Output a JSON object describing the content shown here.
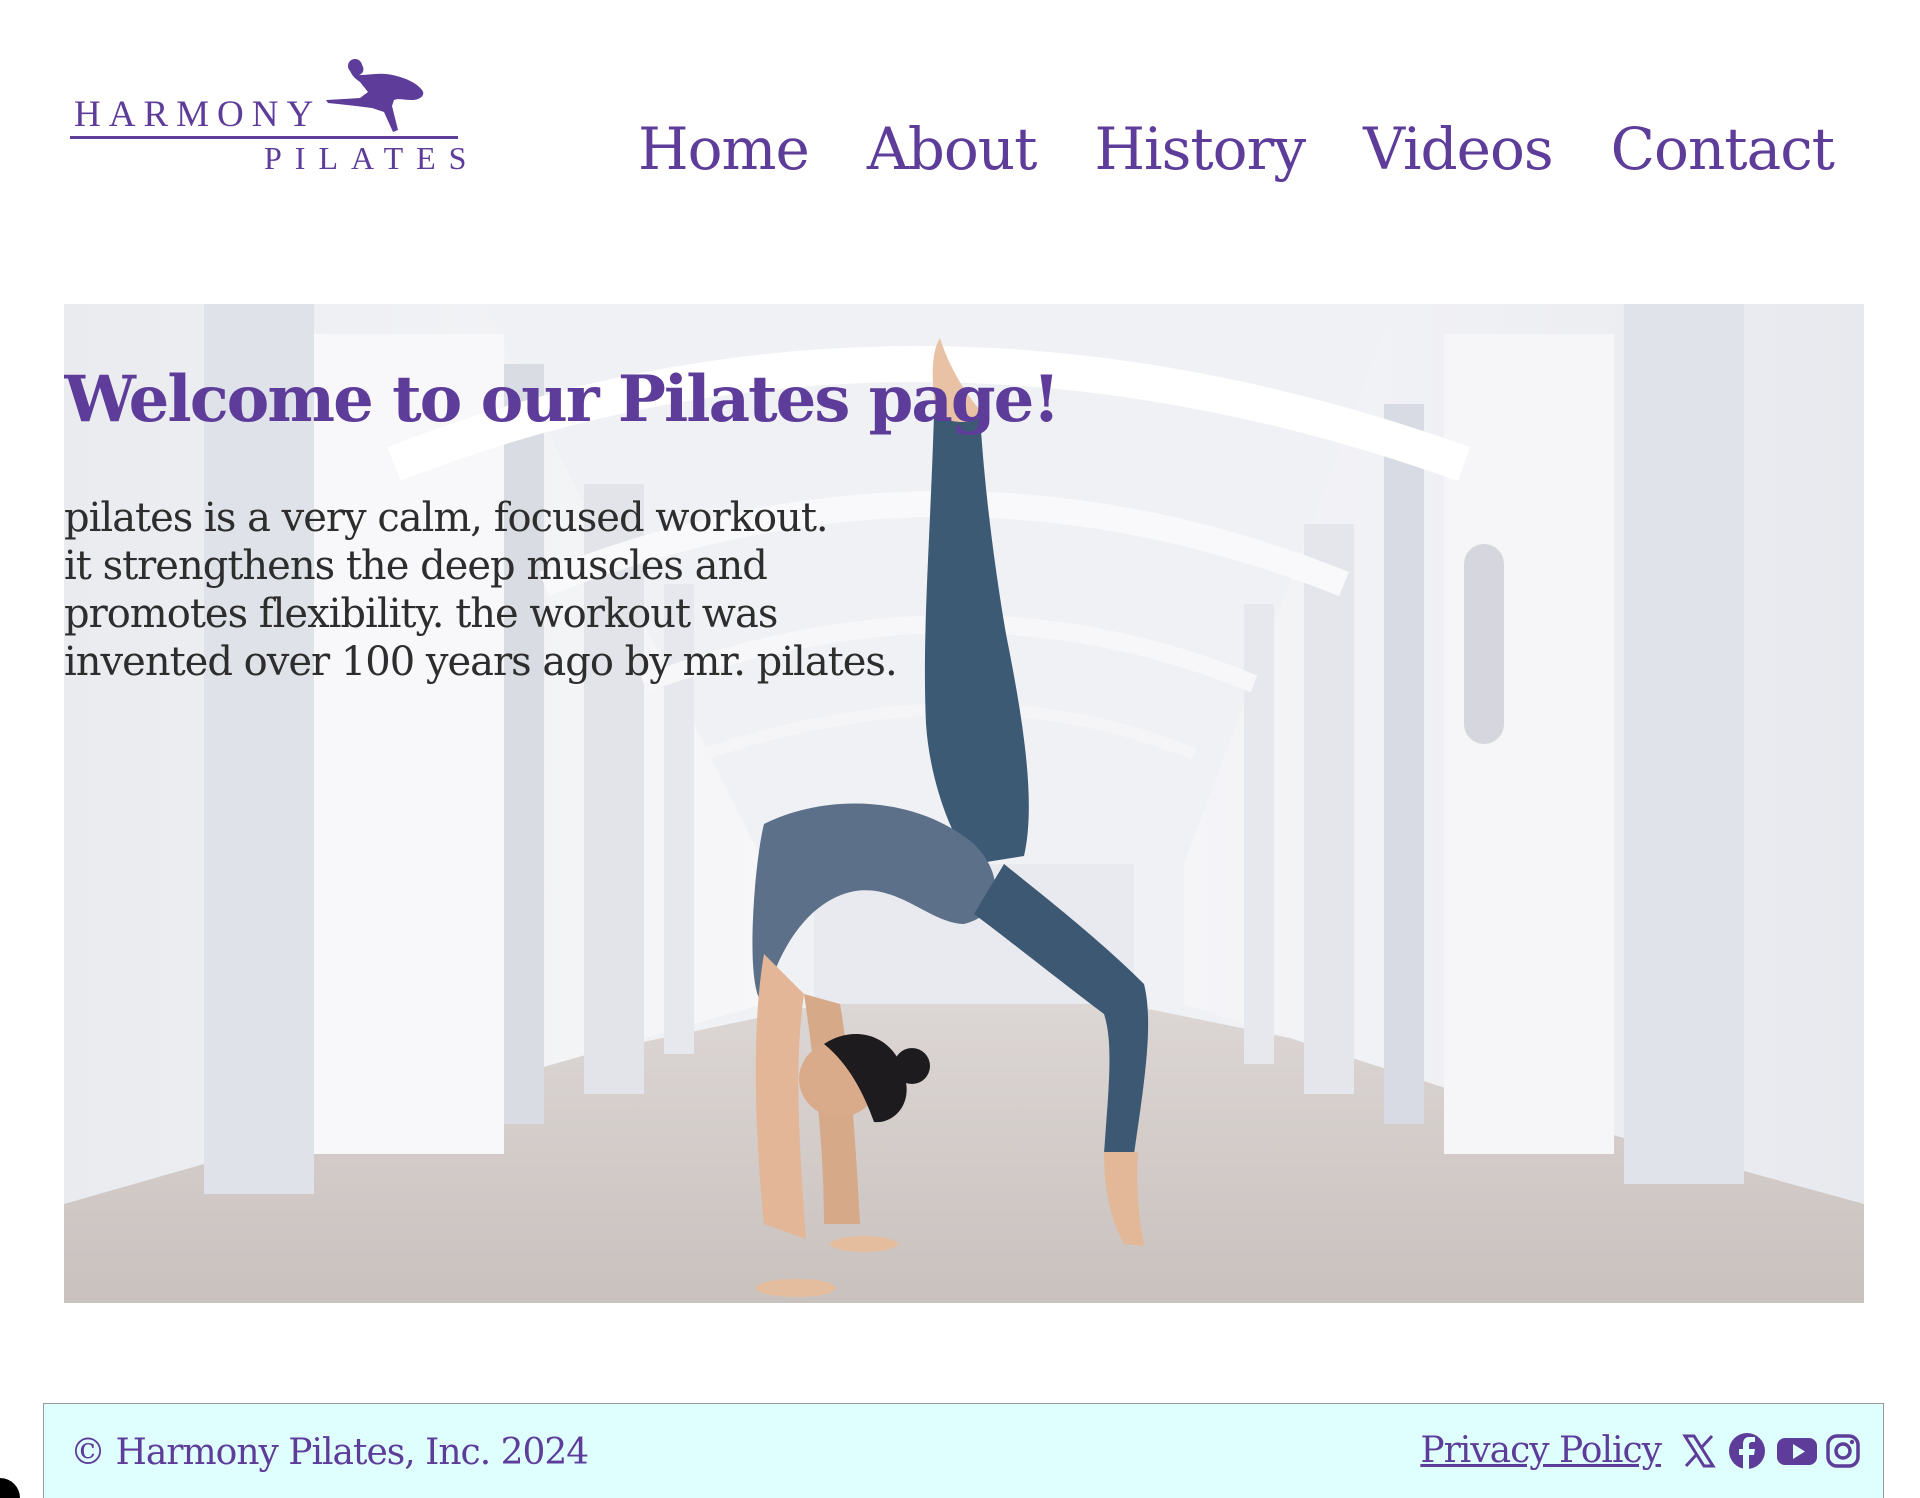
{
  "header": {
    "logo": {
      "line1": "HARMONY",
      "line2": "PILATES"
    },
    "nav": [
      {
        "label": "Home"
      },
      {
        "label": "About"
      },
      {
        "label": "History"
      },
      {
        "label": "Videos"
      },
      {
        "label": "Contact"
      }
    ]
  },
  "hero": {
    "title": "Welcome to our Pilates page!",
    "lines": [
      "pilates is a very calm, focused workout.",
      "it strengthens the deep muscles and",
      "promotes flexibility. the workout was",
      "invented over 100 years ago by mr. pilates."
    ],
    "image": "woman performing a one-legged backbend in a white arched corridor"
  },
  "footer": {
    "copyright": "© Harmony Pilates, Inc. 2024",
    "privacy_label": "Privacy Policy",
    "social_icons": [
      "x-icon",
      "facebook-icon",
      "youtube-icon",
      "instagram-icon"
    ]
  },
  "colors": {
    "brand_purple": "#5e3c99",
    "footer_bg": "#dffffe",
    "text_dark": "#2d2d2d"
  }
}
